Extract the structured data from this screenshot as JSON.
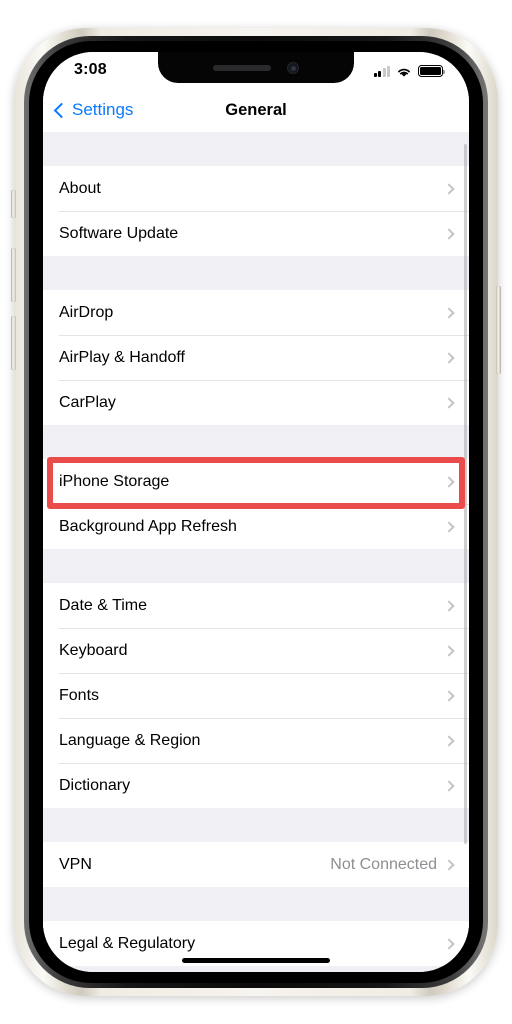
{
  "device": {
    "frame": "iphone",
    "buttons": [
      "mute-switch",
      "volume-up",
      "volume-down",
      "side-button"
    ]
  },
  "status_bar": {
    "time": "3:08",
    "signal_icon": "cellular-signal-icon",
    "signal_bars_filled": 2,
    "signal_bars_total": 4,
    "wifi_icon": "wifi-icon",
    "battery_icon": "battery-icon",
    "battery_level": 100
  },
  "nav_bar": {
    "back_label": "Settings",
    "back_icon": "chevron-left-icon",
    "title": "General"
  },
  "annotation": {
    "color": "#ea4b4b",
    "target": "iPhone Storage"
  },
  "colors": {
    "accent_blue": "#0a7aff",
    "list_background": "#efeff4",
    "row_background": "#ffffff",
    "separator": "#e4e4e6",
    "secondary_text": "#8e8e93",
    "chevron": "#c4c4c6",
    "highlight_red": "#ea4b4b"
  },
  "list": {
    "groups": [
      {
        "rows": [
          {
            "label": "About",
            "value": "",
            "accessory": "chevron-right-icon",
            "highlighted": false
          },
          {
            "label": "Software Update",
            "value": "",
            "accessory": "chevron-right-icon",
            "highlighted": false
          }
        ]
      },
      {
        "rows": [
          {
            "label": "AirDrop",
            "value": "",
            "accessory": "chevron-right-icon",
            "highlighted": false
          },
          {
            "label": "AirPlay & Handoff",
            "value": "",
            "accessory": "chevron-right-icon",
            "highlighted": false
          },
          {
            "label": "CarPlay",
            "value": "",
            "accessory": "chevron-right-icon",
            "highlighted": false
          }
        ]
      },
      {
        "rows": [
          {
            "label": "iPhone Storage",
            "value": "",
            "accessory": "chevron-right-icon",
            "highlighted": true
          },
          {
            "label": "Background App Refresh",
            "value": "",
            "accessory": "chevron-right-icon",
            "highlighted": false
          }
        ]
      },
      {
        "rows": [
          {
            "label": "Date & Time",
            "value": "",
            "accessory": "chevron-right-icon",
            "highlighted": false
          },
          {
            "label": "Keyboard",
            "value": "",
            "accessory": "chevron-right-icon",
            "highlighted": false
          },
          {
            "label": "Fonts",
            "value": "",
            "accessory": "chevron-right-icon",
            "highlighted": false
          },
          {
            "label": "Language & Region",
            "value": "",
            "accessory": "chevron-right-icon",
            "highlighted": false
          },
          {
            "label": "Dictionary",
            "value": "",
            "accessory": "chevron-right-icon",
            "highlighted": false
          }
        ]
      },
      {
        "rows": [
          {
            "label": "VPN",
            "value": "Not Connected",
            "accessory": "chevron-right-icon",
            "highlighted": false
          }
        ]
      },
      {
        "rows": [
          {
            "label": "Legal & Regulatory",
            "value": "",
            "accessory": "chevron-right-icon",
            "highlighted": false
          }
        ]
      }
    ]
  }
}
